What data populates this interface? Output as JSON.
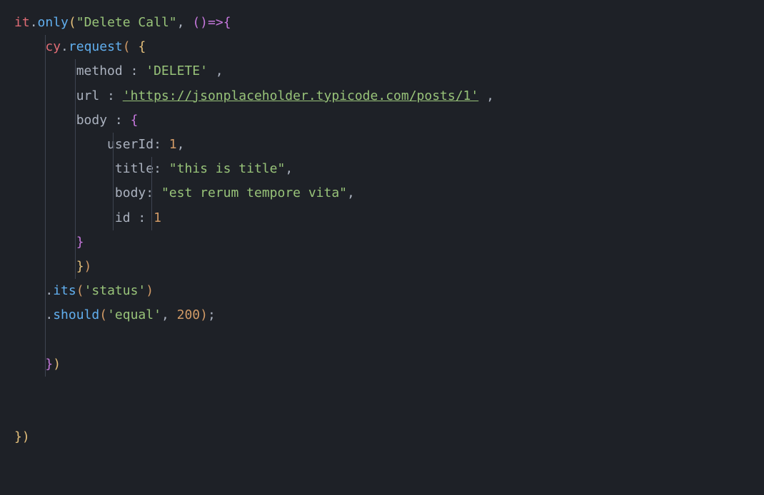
{
  "code": {
    "l1": {
      "it": "it",
      "only": "only",
      "str": "\"Delete Call\"",
      "arrow": "=>"
    },
    "l2": {
      "cy": "cy",
      "request": "request"
    },
    "l3": {
      "method": "method",
      "val": "'DELETE'"
    },
    "l4": {
      "url": "url",
      "val": "'https://jsonplaceholder.typicode.com/posts/1'"
    },
    "l5": {
      "body": "body"
    },
    "l6": {
      "userId": "userId",
      "val": "1"
    },
    "l7": {
      "title": "title",
      "val": "\"this is title\""
    },
    "l8": {
      "body": "body",
      "val": "\"est rerum tempore vita\""
    },
    "l9": {
      "id": "id",
      "val": "1"
    },
    "l12": {
      "its": "its",
      "val": "'status'"
    },
    "l13": {
      "should": "should",
      "val": "'equal'",
      "num": "200"
    }
  }
}
